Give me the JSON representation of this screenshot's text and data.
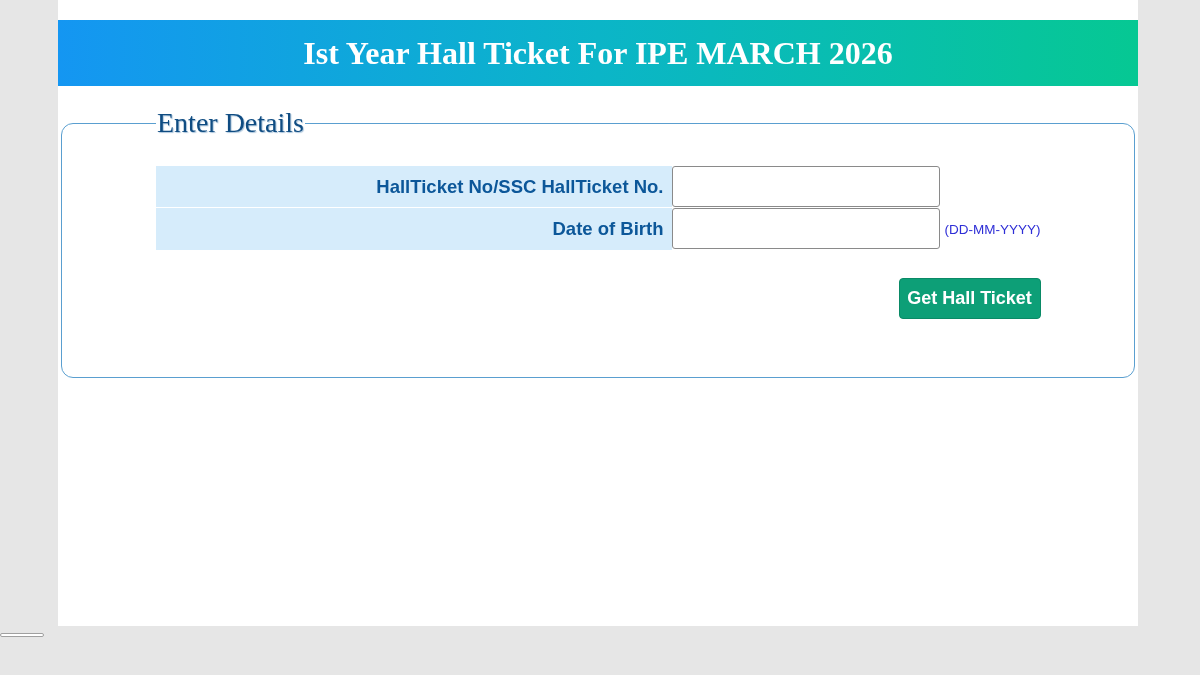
{
  "header": {
    "title": "Ist Year Hall Ticket For IPE MARCH 2026"
  },
  "form": {
    "legend": "Enter Details",
    "fields": [
      {
        "label": "HallTicket No/SSC HallTicket No."
      },
      {
        "label": "Date of Birth",
        "hint": "(DD-MM-YYYY)"
      }
    ],
    "submit_button": "Get Hall Ticket"
  }
}
